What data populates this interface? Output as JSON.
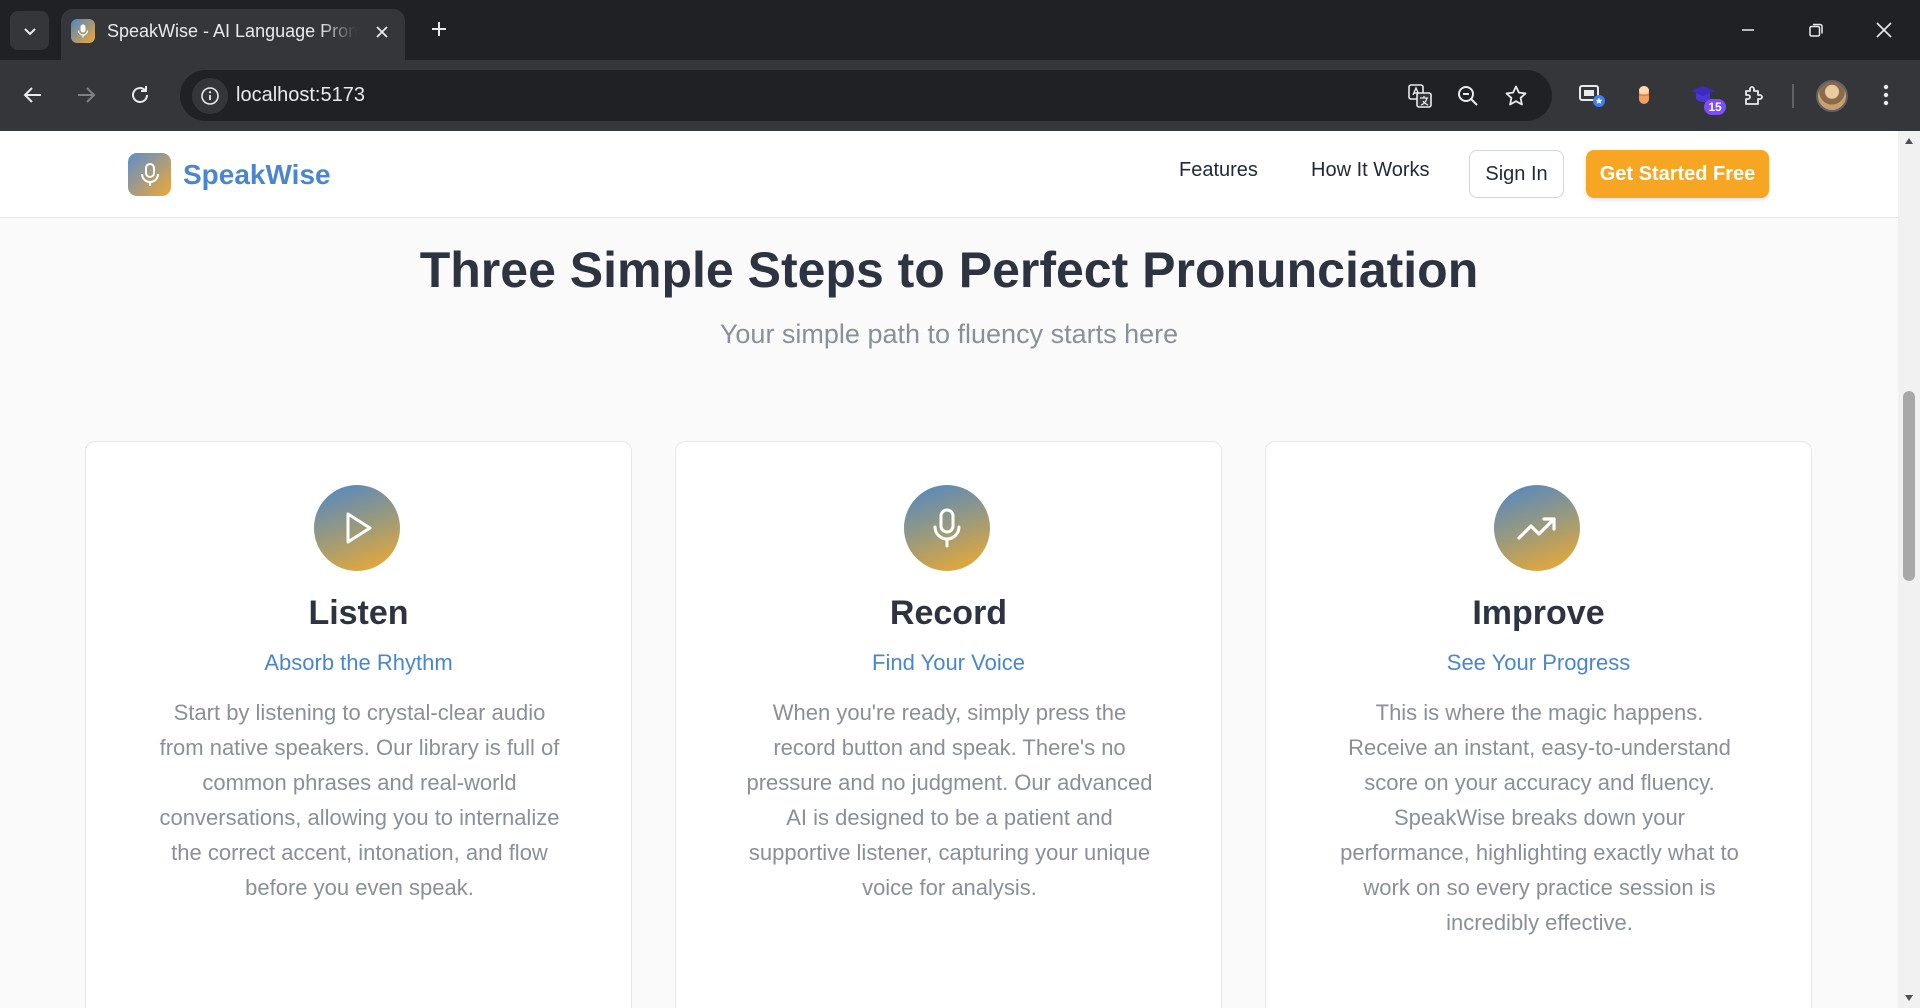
{
  "browser": {
    "tab_title": "SpeakWise - AI Language Pronunciation",
    "url": "localhost:5173",
    "extension_badge": "15"
  },
  "header": {
    "brand": "SpeakWise",
    "nav": [
      "Features",
      "How It Works"
    ],
    "signin": "Sign In",
    "cta": "Get Started Free"
  },
  "section": {
    "title": "Three Simple Steps to Perfect Pronunciation",
    "subtitle": "Your simple path to fluency starts here"
  },
  "cards": [
    {
      "icon": "play-icon",
      "title": "Listen",
      "subtitle": "Absorb the Rhythm",
      "body": "Start by listening to crystal-clear audio from native speakers. Our library is full of common phrases and real-world conversations, allowing you to internalize the correct accent, intonation, and flow before you even speak."
    },
    {
      "icon": "microphone-icon",
      "title": "Record",
      "subtitle": "Find Your Voice",
      "body": "When you're ready, simply press the record button and speak. There's no pressure and no judgment. Our advanced AI is designed to be a patient and supportive listener, capturing your unique voice for analysis."
    },
    {
      "icon": "trending-up-icon",
      "title": "Improve",
      "subtitle": "See Your Progress",
      "body": "This is where the magic happens. Receive an instant, easy-to-understand score on your accuracy and fluency. SpeakWise breaks down your performance, highlighting exactly what to work on so every practice session is incredibly effective."
    }
  ],
  "colors": {
    "brand_blue": "#4a86cf",
    "cta_orange": "#f6a623",
    "heading": "#2d3340",
    "muted": "#8a8f99"
  }
}
